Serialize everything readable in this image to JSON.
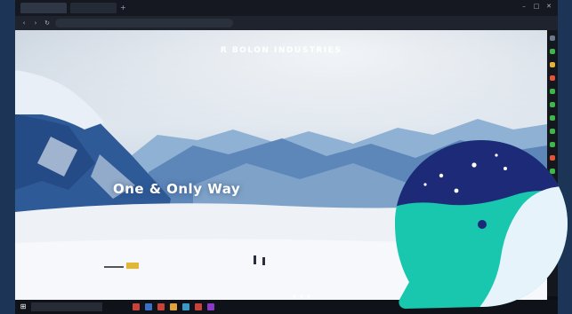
{
  "browser": {
    "tabs": [
      {
        "label": "",
        "active": true
      },
      {
        "label": ""
      }
    ],
    "new_tab_label": "+",
    "url": ""
  },
  "site": {
    "logo_text": "R BOLON INDUSTRIES",
    "top_right_link": "",
    "nav": [
      "",
      "",
      "",
      "",
      "",
      ""
    ],
    "hero_text": "One & Only Way",
    "slide_count": 3
  },
  "taskbar": {
    "search_placeholder": "",
    "clock_time": "",
    "clock_date": ""
  },
  "colors": {
    "page_background": "#1c3556",
    "logo_dark_blue": "#1d2a78",
    "logo_teal": "#19c7ae",
    "logo_light": "#e7f3fb",
    "logo_eye": "#1d2a78"
  },
  "icons": {
    "start": "windows-start-icon",
    "back": "back-arrow-icon",
    "forward": "forward-arrow-icon",
    "reload": "reload-icon",
    "logo": "whale-browser-logo"
  }
}
